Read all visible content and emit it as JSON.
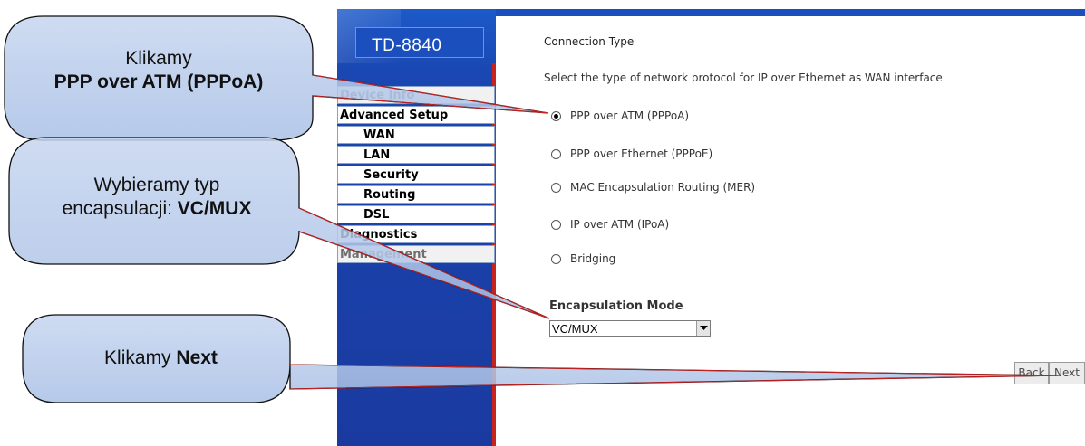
{
  "brand": {
    "model": "TD-8840"
  },
  "menu": {
    "items": [
      {
        "label": "Device Info",
        "level": "top",
        "style": "grey"
      },
      {
        "label": "Advanced Setup",
        "level": "top",
        "style": "white"
      },
      {
        "label": "WAN",
        "level": "sub",
        "style": "white"
      },
      {
        "label": "LAN",
        "level": "sub",
        "style": "white"
      },
      {
        "label": "Security",
        "level": "sub",
        "style": "white"
      },
      {
        "label": "Routing",
        "level": "sub",
        "style": "white"
      },
      {
        "label": "DSL",
        "level": "sub",
        "style": "white"
      },
      {
        "label": "Diagnostics",
        "level": "top",
        "style": "white"
      },
      {
        "label": "Management",
        "level": "top",
        "style": "grey"
      }
    ]
  },
  "main": {
    "section_title": "Connection Type",
    "description": "Select the type of network protocol for IP over Ethernet as WAN interface",
    "options": [
      {
        "label": "PPP over ATM (PPPoA)",
        "selected": true
      },
      {
        "label": "PPP over Ethernet (PPPoE)",
        "selected": false
      },
      {
        "label": "MAC Encapsulation Routing (MER)",
        "selected": false
      },
      {
        "label": "IP over ATM (IPoA)",
        "selected": false
      },
      {
        "label": "Bridging",
        "selected": false
      }
    ],
    "encapsulation_label": "Encapsulation Mode",
    "encapsulation_value": "VC/MUX",
    "back_label": "Back",
    "next_label": "Next"
  },
  "callouts": {
    "c1_line1": "Klikamy",
    "c1_line2": "PPP over ATM (PPPoA)",
    "c2_line1": "Wybieramy typ",
    "c2_line2_prefix": "encapsulacji:",
    "c2_line2_bold": "VC/MUX",
    "c3_prefix": "Klikamy",
    "c3_bold": "Next"
  },
  "colors": {
    "sidebar_blue": "#1a47b2",
    "accent_red": "#c8231c",
    "callout_fill": "#b4c7e7",
    "callout_stroke": "#111111"
  },
  "icons": {
    "select_arrow": "chevron-down-icon"
  }
}
